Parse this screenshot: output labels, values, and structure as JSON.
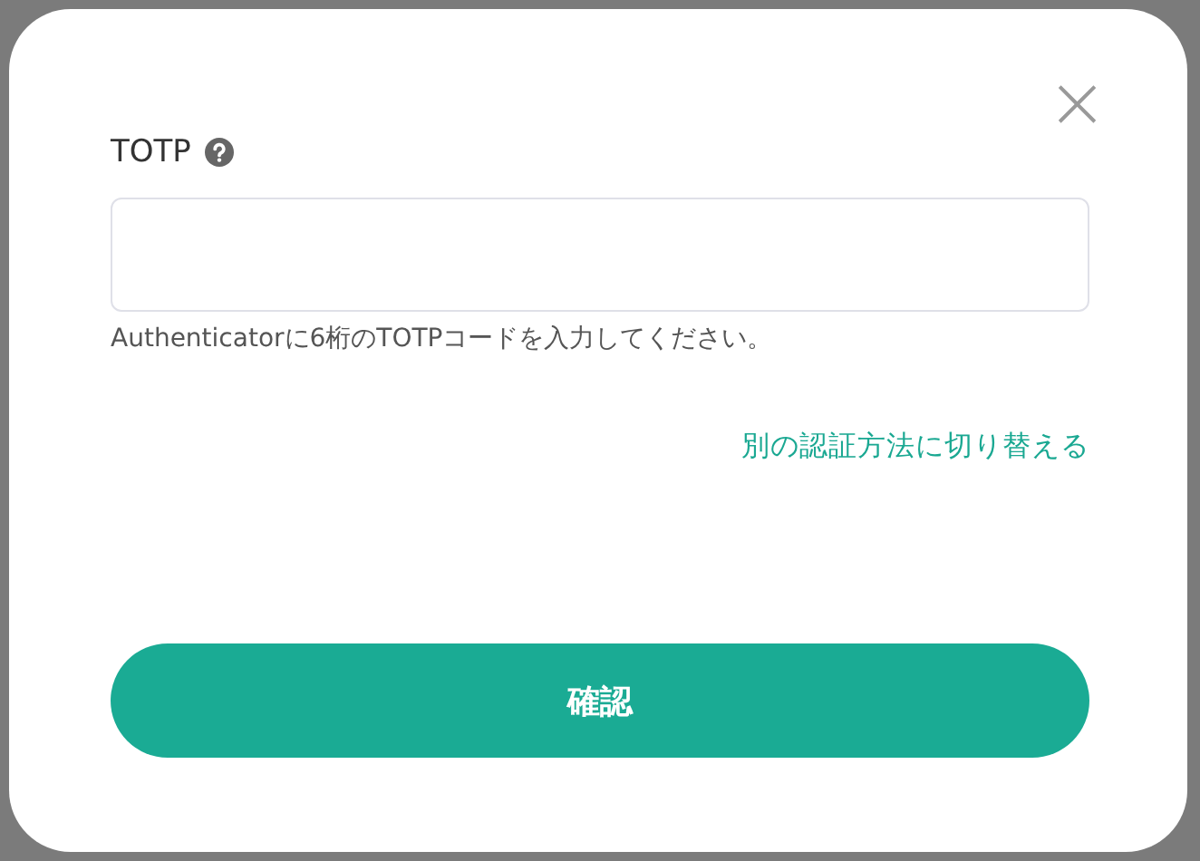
{
  "dialog": {
    "close": "×",
    "field": {
      "label": "TOTP",
      "hint": "Authenticatorに6桁のTOTPコードを入力してください。"
    },
    "switch_link": "別の認証方法に切り替える",
    "buttons": [
      "確認"
    ]
  }
}
